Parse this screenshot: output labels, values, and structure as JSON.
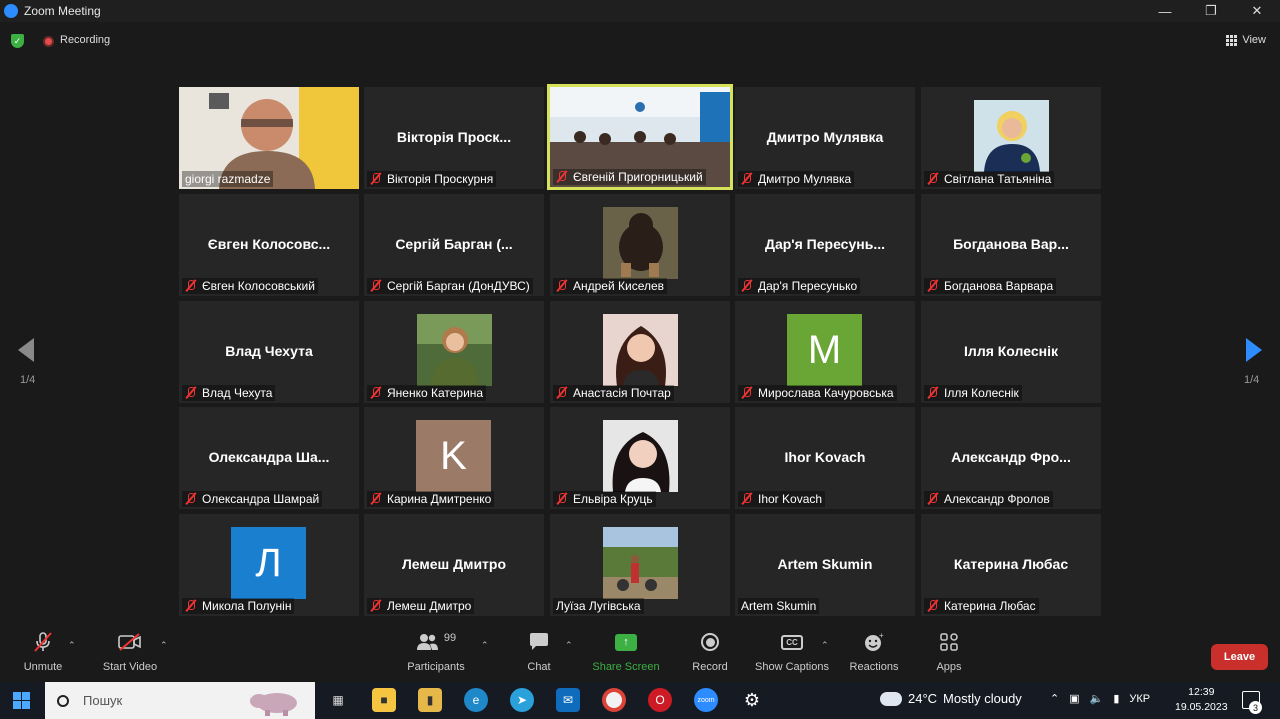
{
  "window": {
    "title": "Zoom Meeting"
  },
  "status": {
    "recording_label": "Recording",
    "view_label": "View"
  },
  "paging": {
    "left_indicator": "1/4",
    "right_indicator": "1/4"
  },
  "tiles": [
    {
      "big_name": "",
      "label": "giorgi razmadze",
      "muted": false,
      "avatar": "photo-man",
      "active": false
    },
    {
      "big_name": "Вікторія  Проск...",
      "label": "Вікторія Проскурня",
      "muted": true,
      "avatar": "",
      "active": false
    },
    {
      "big_name": "",
      "label": "Євгеній Пригорницький",
      "muted": true,
      "avatar": "photo-room",
      "active": true
    },
    {
      "big_name": "Дмитро Мулявка",
      "label": "Дмитро Мулявка",
      "muted": true,
      "avatar": "",
      "active": false
    },
    {
      "big_name": "",
      "label": "Світлана Татьяніна",
      "muted": true,
      "avatar": "photo-woman-blonde",
      "active": false
    },
    {
      "big_name": "Євген  Колосовс...",
      "label": "Євген Колосовський",
      "muted": true,
      "avatar": "",
      "active": false
    },
    {
      "big_name": "Сергій Барган (...",
      "label": "Сергій Барган (ДонДУВС)",
      "muted": true,
      "avatar": "",
      "active": false
    },
    {
      "big_name": "",
      "label": "Андрей Киселев",
      "muted": true,
      "avatar": "photo-dog",
      "active": false
    },
    {
      "big_name": "Дар'я  Пересунь...",
      "label": "Дар'я Пересунько",
      "muted": true,
      "avatar": "",
      "active": false
    },
    {
      "big_name": "Богданова  Вар...",
      "label": "Богданова Варвара",
      "muted": true,
      "avatar": "",
      "active": false
    },
    {
      "big_name": "Влад Чехута",
      "label": "Влад Чехута",
      "muted": true,
      "avatar": "",
      "active": false
    },
    {
      "big_name": "",
      "label": "Яненко Катерина",
      "muted": true,
      "avatar": "photo-woman-park",
      "active": false
    },
    {
      "big_name": "",
      "label": "Анастасія Почтар",
      "muted": true,
      "avatar": "photo-woman-dark",
      "active": false
    },
    {
      "big_name": "",
      "label": "Мирослава Качуровська",
      "muted": true,
      "avatar": "letter-green",
      "letter": "M",
      "active": false
    },
    {
      "big_name": "Ілля Колеснік",
      "label": "Ілля Колеснік",
      "muted": true,
      "avatar": "",
      "active": false
    },
    {
      "big_name": "Олександра  Ша...",
      "label": "Олександра Шамрай",
      "muted": true,
      "avatar": "",
      "active": false
    },
    {
      "big_name": "",
      "label": "Карина Дмитренко",
      "muted": true,
      "avatar": "letter-brown",
      "letter": "K",
      "active": false
    },
    {
      "big_name": "",
      "label": "Ельвіра Круць",
      "muted": true,
      "avatar": "photo-woman-dark2",
      "active": false
    },
    {
      "big_name": "Ihor Kovach",
      "label": "Ihor Kovach",
      "muted": true,
      "avatar": "",
      "active": false
    },
    {
      "big_name": "Александр  Фро...",
      "label": "Александр Фролов",
      "muted": true,
      "avatar": "",
      "active": false
    },
    {
      "big_name": "",
      "label": "Микола Полунін",
      "muted": true,
      "avatar": "letter-blue",
      "letter": "Л",
      "active": false
    },
    {
      "big_name": "Лемеш Дмитро",
      "label": "Лемеш Дмитро",
      "muted": true,
      "avatar": "",
      "active": false
    },
    {
      "big_name": "",
      "label": "Луїза Лугівська",
      "muted": false,
      "avatar": "photo-outdoor",
      "active": false
    },
    {
      "big_name": "Artem Skumin",
      "label": "Artem Skumin",
      "muted": false,
      "avatar": "",
      "active": false
    },
    {
      "big_name": "Катерина Любас",
      "label": "Катерина Любас",
      "muted": true,
      "avatar": "",
      "active": false
    }
  ],
  "toolbar": {
    "unmute": "Unmute",
    "start_video": "Start Video",
    "participants": "Participants",
    "participants_count": "99",
    "chat": "Chat",
    "share_screen": "Share Screen",
    "record": "Record",
    "show_captions": "Show Captions",
    "reactions": "Reactions",
    "apps": "Apps",
    "leave": "Leave"
  },
  "taskbar": {
    "search_placeholder": "Пошук",
    "temperature": "24°C",
    "weather": "Mostly cloudy",
    "language": "УКР",
    "time": "12:39",
    "date": "19.05.2023",
    "notifications": "3"
  },
  "colors": {
    "active_border": "#d6e35a",
    "share_green": "#3cb043",
    "leave_red": "#c9302c",
    "zoom_blue": "#2d8cff",
    "avatar_green": "#6aa636",
    "avatar_brown": "#9b7b68",
    "avatar_blue": "#1b7fd0"
  }
}
